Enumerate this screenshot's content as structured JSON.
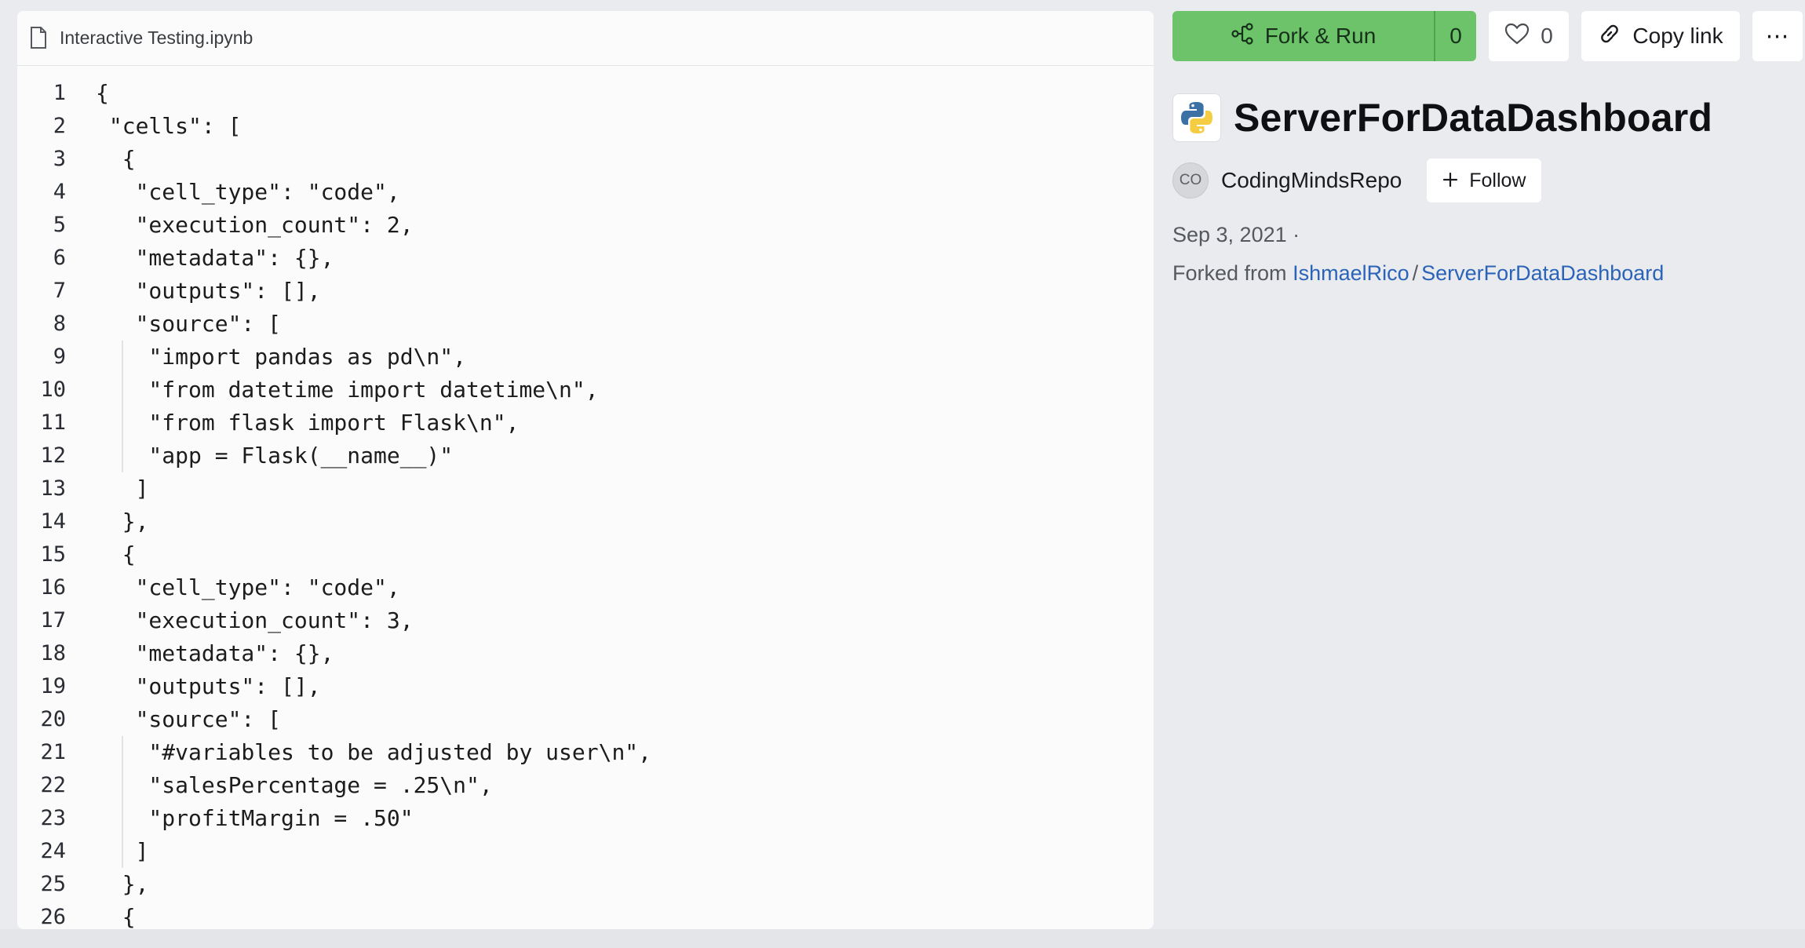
{
  "editor": {
    "file_name": "Interactive Testing.ipynb",
    "lines": [
      {
        "n": "1",
        "text": "{"
      },
      {
        "n": "2",
        "text": " \"cells\": ["
      },
      {
        "n": "3",
        "text": "  {"
      },
      {
        "n": "4",
        "text": "   \"cell_type\": \"code\","
      },
      {
        "n": "5",
        "text": "   \"execution_count\": 2,"
      },
      {
        "n": "6",
        "text": "   \"metadata\": {},"
      },
      {
        "n": "7",
        "text": "   \"outputs\": [],"
      },
      {
        "n": "8",
        "text": "   \"source\": ["
      },
      {
        "n": "9",
        "text": "    \"import pandas as pd\\n\","
      },
      {
        "n": "10",
        "text": "    \"from datetime import datetime\\n\","
      },
      {
        "n": "11",
        "text": "    \"from flask import Flask\\n\","
      },
      {
        "n": "12",
        "text": "    \"app = Flask(__name__)\""
      },
      {
        "n": "13",
        "text": "   ]"
      },
      {
        "n": "14",
        "text": "  },"
      },
      {
        "n": "15",
        "text": "  {"
      },
      {
        "n": "16",
        "text": "   \"cell_type\": \"code\","
      },
      {
        "n": "17",
        "text": "   \"execution_count\": 3,"
      },
      {
        "n": "18",
        "text": "   \"metadata\": {},"
      },
      {
        "n": "19",
        "text": "   \"outputs\": [],"
      },
      {
        "n": "20",
        "text": "   \"source\": ["
      },
      {
        "n": "21",
        "text": "    \"#variables to be adjusted by user\\n\","
      },
      {
        "n": "22",
        "text": "    \"salesPercentage = .25\\n\","
      },
      {
        "n": "23",
        "text": "    \"profitMargin = .50\""
      },
      {
        "n": "24",
        "text": "   ]"
      },
      {
        "n": "25",
        "text": "  },"
      },
      {
        "n": "26",
        "text": "  {"
      }
    ]
  },
  "actions": {
    "fork_label": "Fork & Run",
    "fork_count": "0",
    "like_count": "0",
    "copy_label": "Copy link",
    "more_label": "⋯"
  },
  "repl": {
    "title": "ServerForDataDashboard",
    "language_icon": "python-icon"
  },
  "owner": {
    "avatar_initials": "CO",
    "name": "CodingMindsRepo",
    "follow_label": "Follow"
  },
  "meta": {
    "date": "Sep 3, 2021 ·",
    "forked_prefix": "Forked from",
    "fork_user": "IshmaelRico",
    "fork_separator": "/",
    "fork_repl": "ServerForDataDashboard"
  },
  "colors": {
    "accent_green": "#6cc36a",
    "link_blue": "#2a63b8",
    "page_bg": "#e9ebee"
  }
}
